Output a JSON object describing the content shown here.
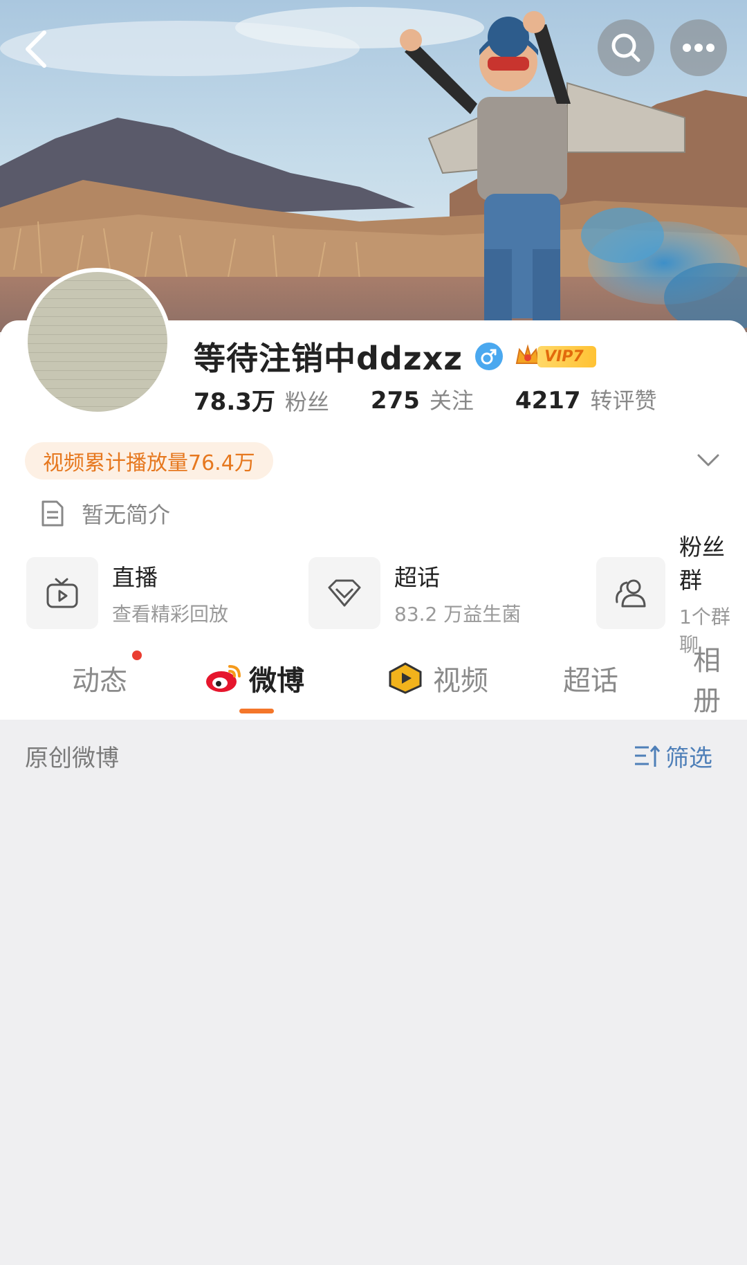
{
  "header": {
    "back_icon": "chevron-left-icon",
    "search_icon": "search-icon",
    "more_icon": "more-dots-icon"
  },
  "profile": {
    "name": "等待注销中ddzxz",
    "gender_symbol": "♂",
    "vip_label": "VIP7",
    "stats": [
      {
        "value": "78.3万",
        "label": "粉丝"
      },
      {
        "value": "275",
        "label": "关注"
      },
      {
        "value": "4217",
        "label": "转评赞"
      }
    ],
    "play_count_badge": "视频累计播放量76.4万",
    "bio": "暂无简介"
  },
  "cards": [
    {
      "title": "直播",
      "subtitle": "查看精彩回放",
      "icon": "tv-play-icon"
    },
    {
      "title": "超话",
      "subtitle": "83.2 万益生菌",
      "icon": "diamond-icon"
    },
    {
      "title": "粉丝群",
      "subtitle": "1个群聊",
      "icon": "group-users-icon"
    }
  ],
  "tabs": [
    {
      "label": "动态",
      "has_dot": true
    },
    {
      "label": "微博",
      "active": true
    },
    {
      "label": "视频"
    },
    {
      "label": "超话"
    },
    {
      "label": "相册"
    }
  ],
  "filter": {
    "title": "原创微博",
    "button": "筛选"
  },
  "colors": {
    "accent_orange": "#f4762a",
    "link_blue": "#4e7fb8",
    "badge_bg": "#fdf0e4"
  }
}
